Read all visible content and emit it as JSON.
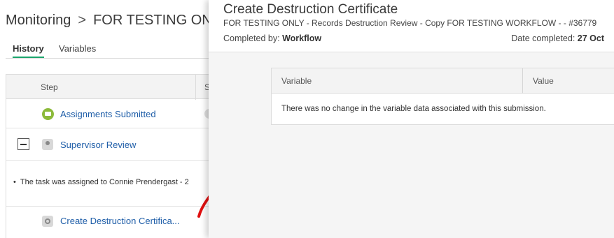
{
  "background": {
    "breadcrumb": {
      "root": "Monitoring",
      "separator": ">",
      "current": "FOR TESTING ONLY"
    },
    "tabs": [
      {
        "label": "History",
        "active": true
      },
      {
        "label": "Variables",
        "active": false
      }
    ],
    "table": {
      "columns": [
        "Step",
        "S"
      ],
      "rows": [
        {
          "icon": "mail-icon",
          "label": "Assignments Submitted"
        },
        {
          "icon": "user-icon",
          "label": "Supervisor Review",
          "collapsible": true
        },
        {
          "detail": "The task was assigned to Connie Prendergast - 2"
        },
        {
          "icon": "gear-icon",
          "label": "Create Destruction Certifica..."
        }
      ]
    }
  },
  "panel": {
    "title": "Create Destruction Certificate",
    "subtitle": "FOR TESTING ONLY - Records Destruction Review - Copy FOR TESTING WORKFLOW - - #36779",
    "completed_by_label": "Completed by:",
    "completed_by_value": "Workflow",
    "date_completed_label": "Date completed:",
    "date_completed_value": "27 Oct",
    "variables_table": {
      "columns": [
        "Variable",
        "Value"
      ],
      "empty_message": "There was no change in the variable data associated with this submission."
    }
  },
  "colors": {
    "accent_green": "#1aa56c",
    "link_blue": "#1f5ea8",
    "annotation_red": "#e01010"
  }
}
